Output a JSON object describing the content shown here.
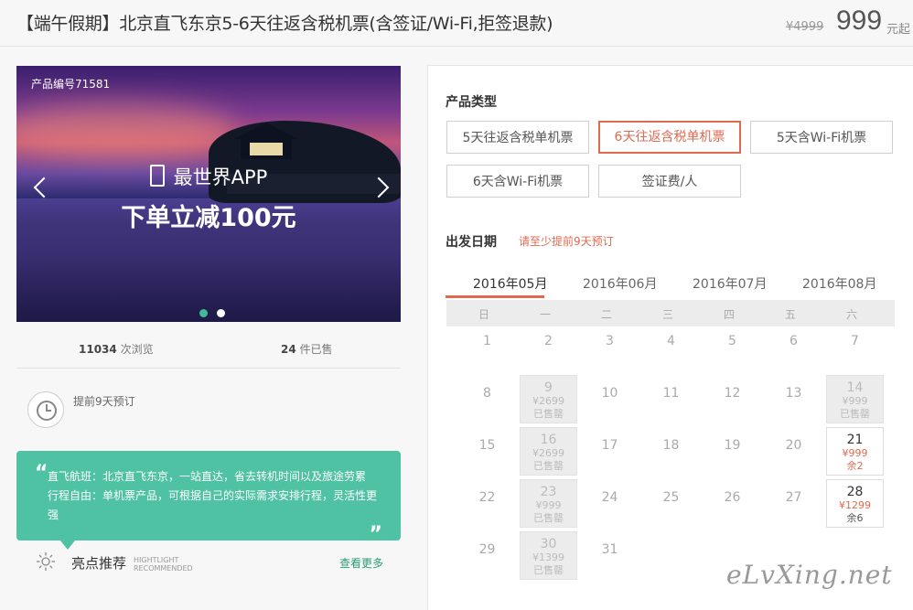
{
  "header": {
    "title": "【端午假期】北京直飞东京5-6天往返含税机票(含签证/Wi-Fi,拒签退款)",
    "old_price": "¥4999",
    "price": "999",
    "price_unit": "元起"
  },
  "banner": {
    "product_no": "产品编号71581",
    "app_line": "最世界APP",
    "promo": "下单立减100元",
    "active_dot_color": "#3fb99a",
    "inactive_dot_color": "#ffffff"
  },
  "stats": {
    "views_count": "11034",
    "views_label": "次浏览",
    "sold_count": "24",
    "sold_label": "件已售"
  },
  "advance_booking": "提前9天预订",
  "intro": "直飞航班：北京直飞东京，一站直达，省去转机时间以及旅途劳累 行程自由：单机票产品，可根据自己的实际需求安排行程，灵活性更强",
  "highlights": {
    "title": "亮点推荐",
    "en_line1": "HIGHTLIGHT",
    "en_line2": "RECOMMENDED",
    "more": "查看更多"
  },
  "product_type": {
    "title": "产品类型",
    "options": [
      "5天往返含税单机票",
      "6天往返含税单机票",
      "5天含Wi-Fi机票",
      "6天含Wi-Fi机票",
      "签证费/人"
    ],
    "selected_index": 1
  },
  "departure": {
    "title": "出发日期",
    "hint": "请至少提前9天预订",
    "months": [
      "2016年05月",
      "2016年06月",
      "2016年07月",
      "2016年08月"
    ],
    "active_month": "2016年05月",
    "weekdays": [
      "日",
      "一",
      "二",
      "三",
      "四",
      "五",
      "六"
    ],
    "days": [
      {
        "day": "1",
        "col": 0,
        "row": 0
      },
      {
        "day": "2",
        "col": 1,
        "row": 0
      },
      {
        "day": "3",
        "col": 2,
        "row": 0
      },
      {
        "day": "4",
        "col": 3,
        "row": 0
      },
      {
        "day": "5",
        "col": 4,
        "row": 0
      },
      {
        "day": "6",
        "col": 5,
        "row": 0
      },
      {
        "day": "7",
        "col": 6,
        "row": 0
      },
      {
        "day": "8",
        "col": 0,
        "row": 1
      },
      {
        "day": "9",
        "col": 1,
        "row": 1,
        "price": "¥2699",
        "status": "已售罄",
        "type": "soldout"
      },
      {
        "day": "10",
        "col": 2,
        "row": 1
      },
      {
        "day": "11",
        "col": 3,
        "row": 1
      },
      {
        "day": "12",
        "col": 4,
        "row": 1
      },
      {
        "day": "13",
        "col": 5,
        "row": 1
      },
      {
        "day": "14",
        "col": 6,
        "row": 1,
        "price": "¥999",
        "status": "已售罄",
        "type": "soldout"
      },
      {
        "day": "15",
        "col": 0,
        "row": 2
      },
      {
        "day": "16",
        "col": 1,
        "row": 2,
        "price": "¥2699",
        "status": "已售罄",
        "type": "soldout"
      },
      {
        "day": "17",
        "col": 2,
        "row": 2
      },
      {
        "day": "18",
        "col": 3,
        "row": 2
      },
      {
        "day": "19",
        "col": 4,
        "row": 2
      },
      {
        "day": "20",
        "col": 5,
        "row": 2
      },
      {
        "day": "21",
        "col": 6,
        "row": 2,
        "price": "¥999",
        "status": "余2",
        "type": "avail"
      },
      {
        "day": "22",
        "col": 0,
        "row": 3
      },
      {
        "day": "23",
        "col": 1,
        "row": 3,
        "price": "¥999",
        "status": "已售罄",
        "type": "soldout"
      },
      {
        "day": "24",
        "col": 2,
        "row": 3
      },
      {
        "day": "25",
        "col": 3,
        "row": 3
      },
      {
        "day": "26",
        "col": 4,
        "row": 3
      },
      {
        "day": "27",
        "col": 5,
        "row": 3
      },
      {
        "day": "28",
        "col": 6,
        "row": 3,
        "price": "¥1299",
        "status": "余6",
        "type": "avail",
        "status_dark": true
      },
      {
        "day": "29",
        "col": 0,
        "row": 4
      },
      {
        "day": "30",
        "col": 1,
        "row": 4,
        "price": "¥1399",
        "status": "已售罄",
        "type": "soldout"
      },
      {
        "day": "31",
        "col": 2,
        "row": 4
      }
    ]
  },
  "watermark": "eLvXing.net"
}
